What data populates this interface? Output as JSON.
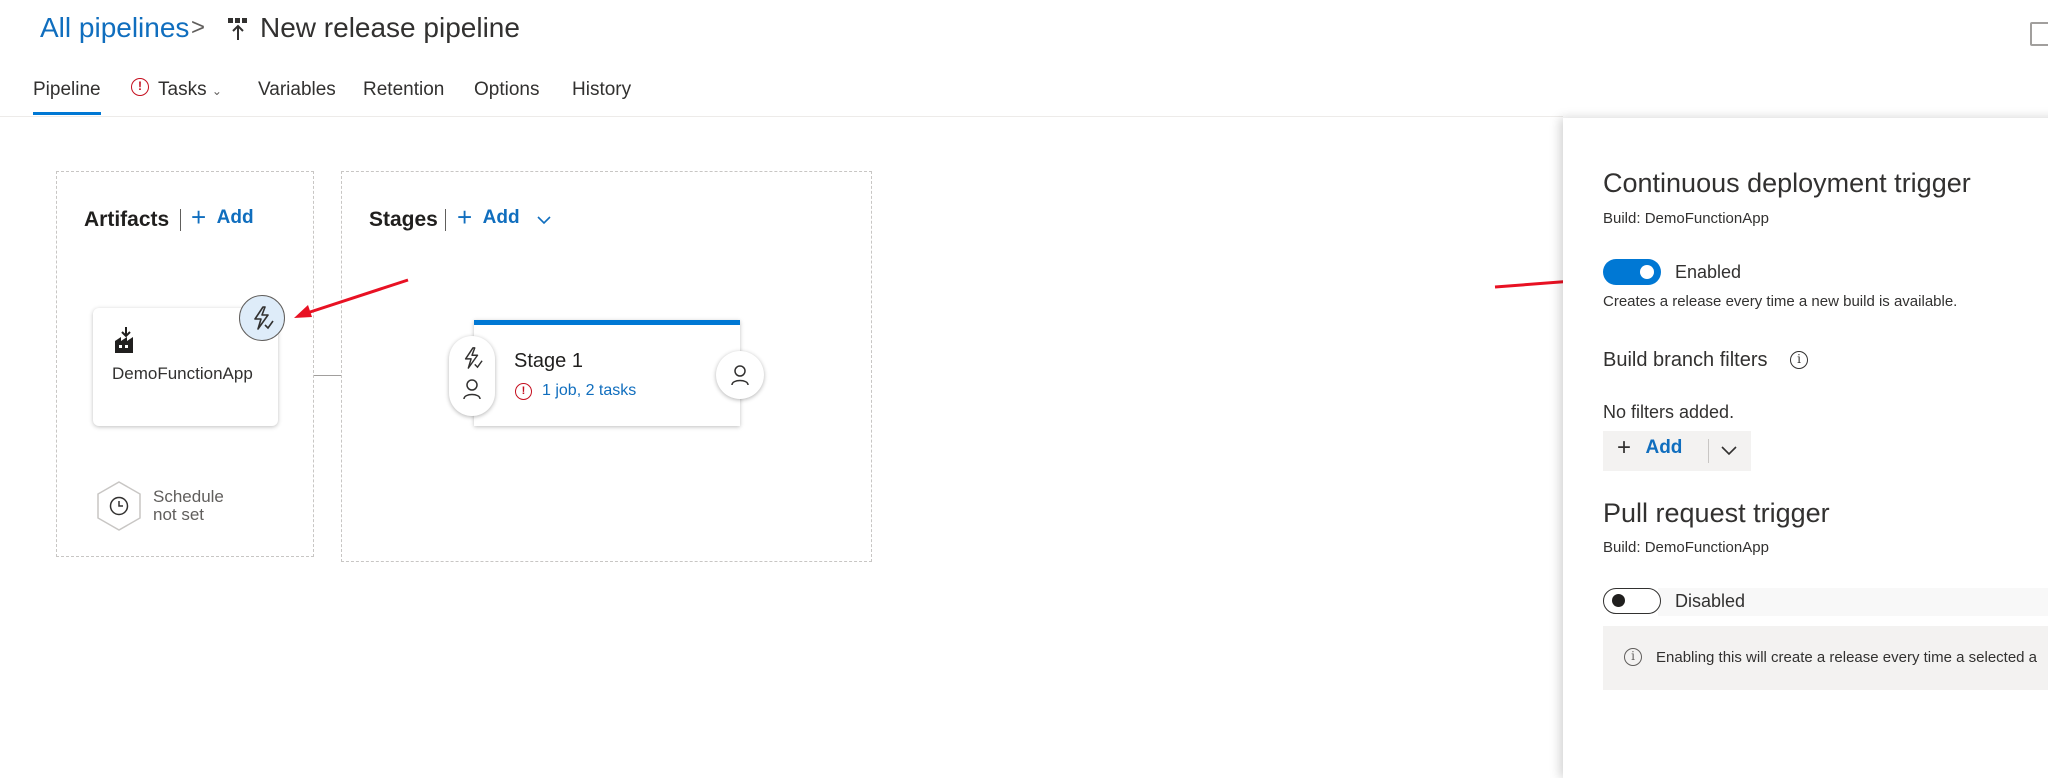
{
  "header": {
    "breadcrumb_root": "All pipelines",
    "breadcrumb_separator": ">",
    "title": "New release pipeline"
  },
  "tabs": [
    {
      "label": "Pipeline",
      "active": true
    },
    {
      "label": "Tasks",
      "error": true,
      "error_glyph": "!",
      "chevron": "⌄"
    },
    {
      "label": "Variables"
    },
    {
      "label": "Retention"
    },
    {
      "label": "Options"
    },
    {
      "label": "History"
    }
  ],
  "artifacts": {
    "title": "Artifacts",
    "add_label": "Add",
    "plus": "+",
    "card_name": "DemoFunctionApp",
    "schedule_line1": "Schedule",
    "schedule_line2": "not set"
  },
  "stages": {
    "title": "Stages",
    "add_label": "Add",
    "plus": "+",
    "stage_name": "Stage 1",
    "stage_error_glyph": "!",
    "stage_tasks": "1 job, 2 tasks"
  },
  "panel": {
    "cd_title": "Continuous deployment trigger",
    "cd_build": "Build: DemoFunctionApp",
    "cd_toggle_label": "Enabled",
    "cd_desc": "Creates a release every time a new build is available.",
    "branch_filters_title": "Build branch filters",
    "info_glyph": "i",
    "no_filters": "No filters added.",
    "add_label": "Add",
    "plus": "+",
    "pr_title": "Pull request trigger",
    "pr_build": "Build: DemoFunctionApp",
    "pr_toggle_label": "Disabled",
    "pr_info": "Enabling this will create a release every time a selected a"
  },
  "icons": {
    "pipeline": "release-pipeline-icon",
    "trigger": "lightning-icon",
    "approver": "person-icon",
    "schedule": "clock-icon",
    "artifact": "build-artifact-icon",
    "save": "save-icon"
  },
  "colors": {
    "accent": "#0078d4",
    "link": "#106ebe",
    "error": "#c50f1f",
    "annotation_arrow": "#e81123"
  }
}
